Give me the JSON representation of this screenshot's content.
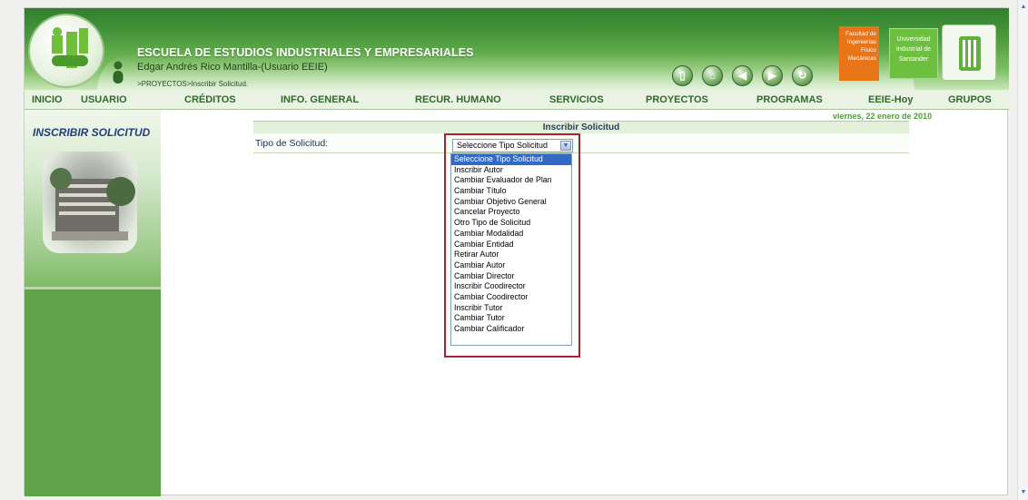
{
  "header": {
    "org_title": "ESCUELA DE ESTUDIOS INDUSTRIALES Y EMPRESARIALES",
    "user": "Edgar Andrés Rico Mantilla-(Usuario EEIE)",
    "breadcrumb": ">PROYECTOS>Inscribir Solicitud.",
    "faculty_badge": "Facultad de Ingenierías Fisico Mecánicas",
    "univ_badge": "Universidad Industrial de Santander",
    "nav_icons": [
      "book-icon",
      "home-icon",
      "back-icon",
      "forward-icon",
      "refresh-icon"
    ]
  },
  "mainnav": {
    "items": [
      "INICIO",
      "USUARIO",
      "CRÉDITOS",
      "INFO. GENERAL",
      "RECUR. HUMANO",
      "SERVICIOS",
      "PROYECTOS",
      "PROGRAMAS",
      "EEIE-Hoy",
      "GRUPOS"
    ]
  },
  "date": "viernes, 22 enero de 2010",
  "sidebar": {
    "title": "INSCRIBIR SOLICITUD"
  },
  "form": {
    "title": "Inscribir Solicitud",
    "label": "Tipo de Solicitud:",
    "selected": "Seleccione Tipo Solicitud",
    "options": [
      "Seleccione Tipo Solicitud",
      "Inscribir Autor",
      "Cambiar Evaluador de Plan",
      "Cambiar Título",
      "Cambiar Objetivo General",
      "Cancelar Proyecto",
      "Otro Tipo de Solicitud",
      "Cambiar Modalidad",
      "Cambiar Entidad",
      "Retirar Autor",
      "Cambiar Autor",
      "Cambiar Director",
      "Inscribir Coodirector",
      "Cambiar Coodirector",
      "Inscribir Tutor",
      "Cambiar Tutor",
      "Cambiar Calificador"
    ]
  },
  "colors": {
    "header_green": "#4f9d3f",
    "sidebar_green": "#5fa448",
    "highlight_red": "#b0202a",
    "select_blue": "#316ac5"
  }
}
